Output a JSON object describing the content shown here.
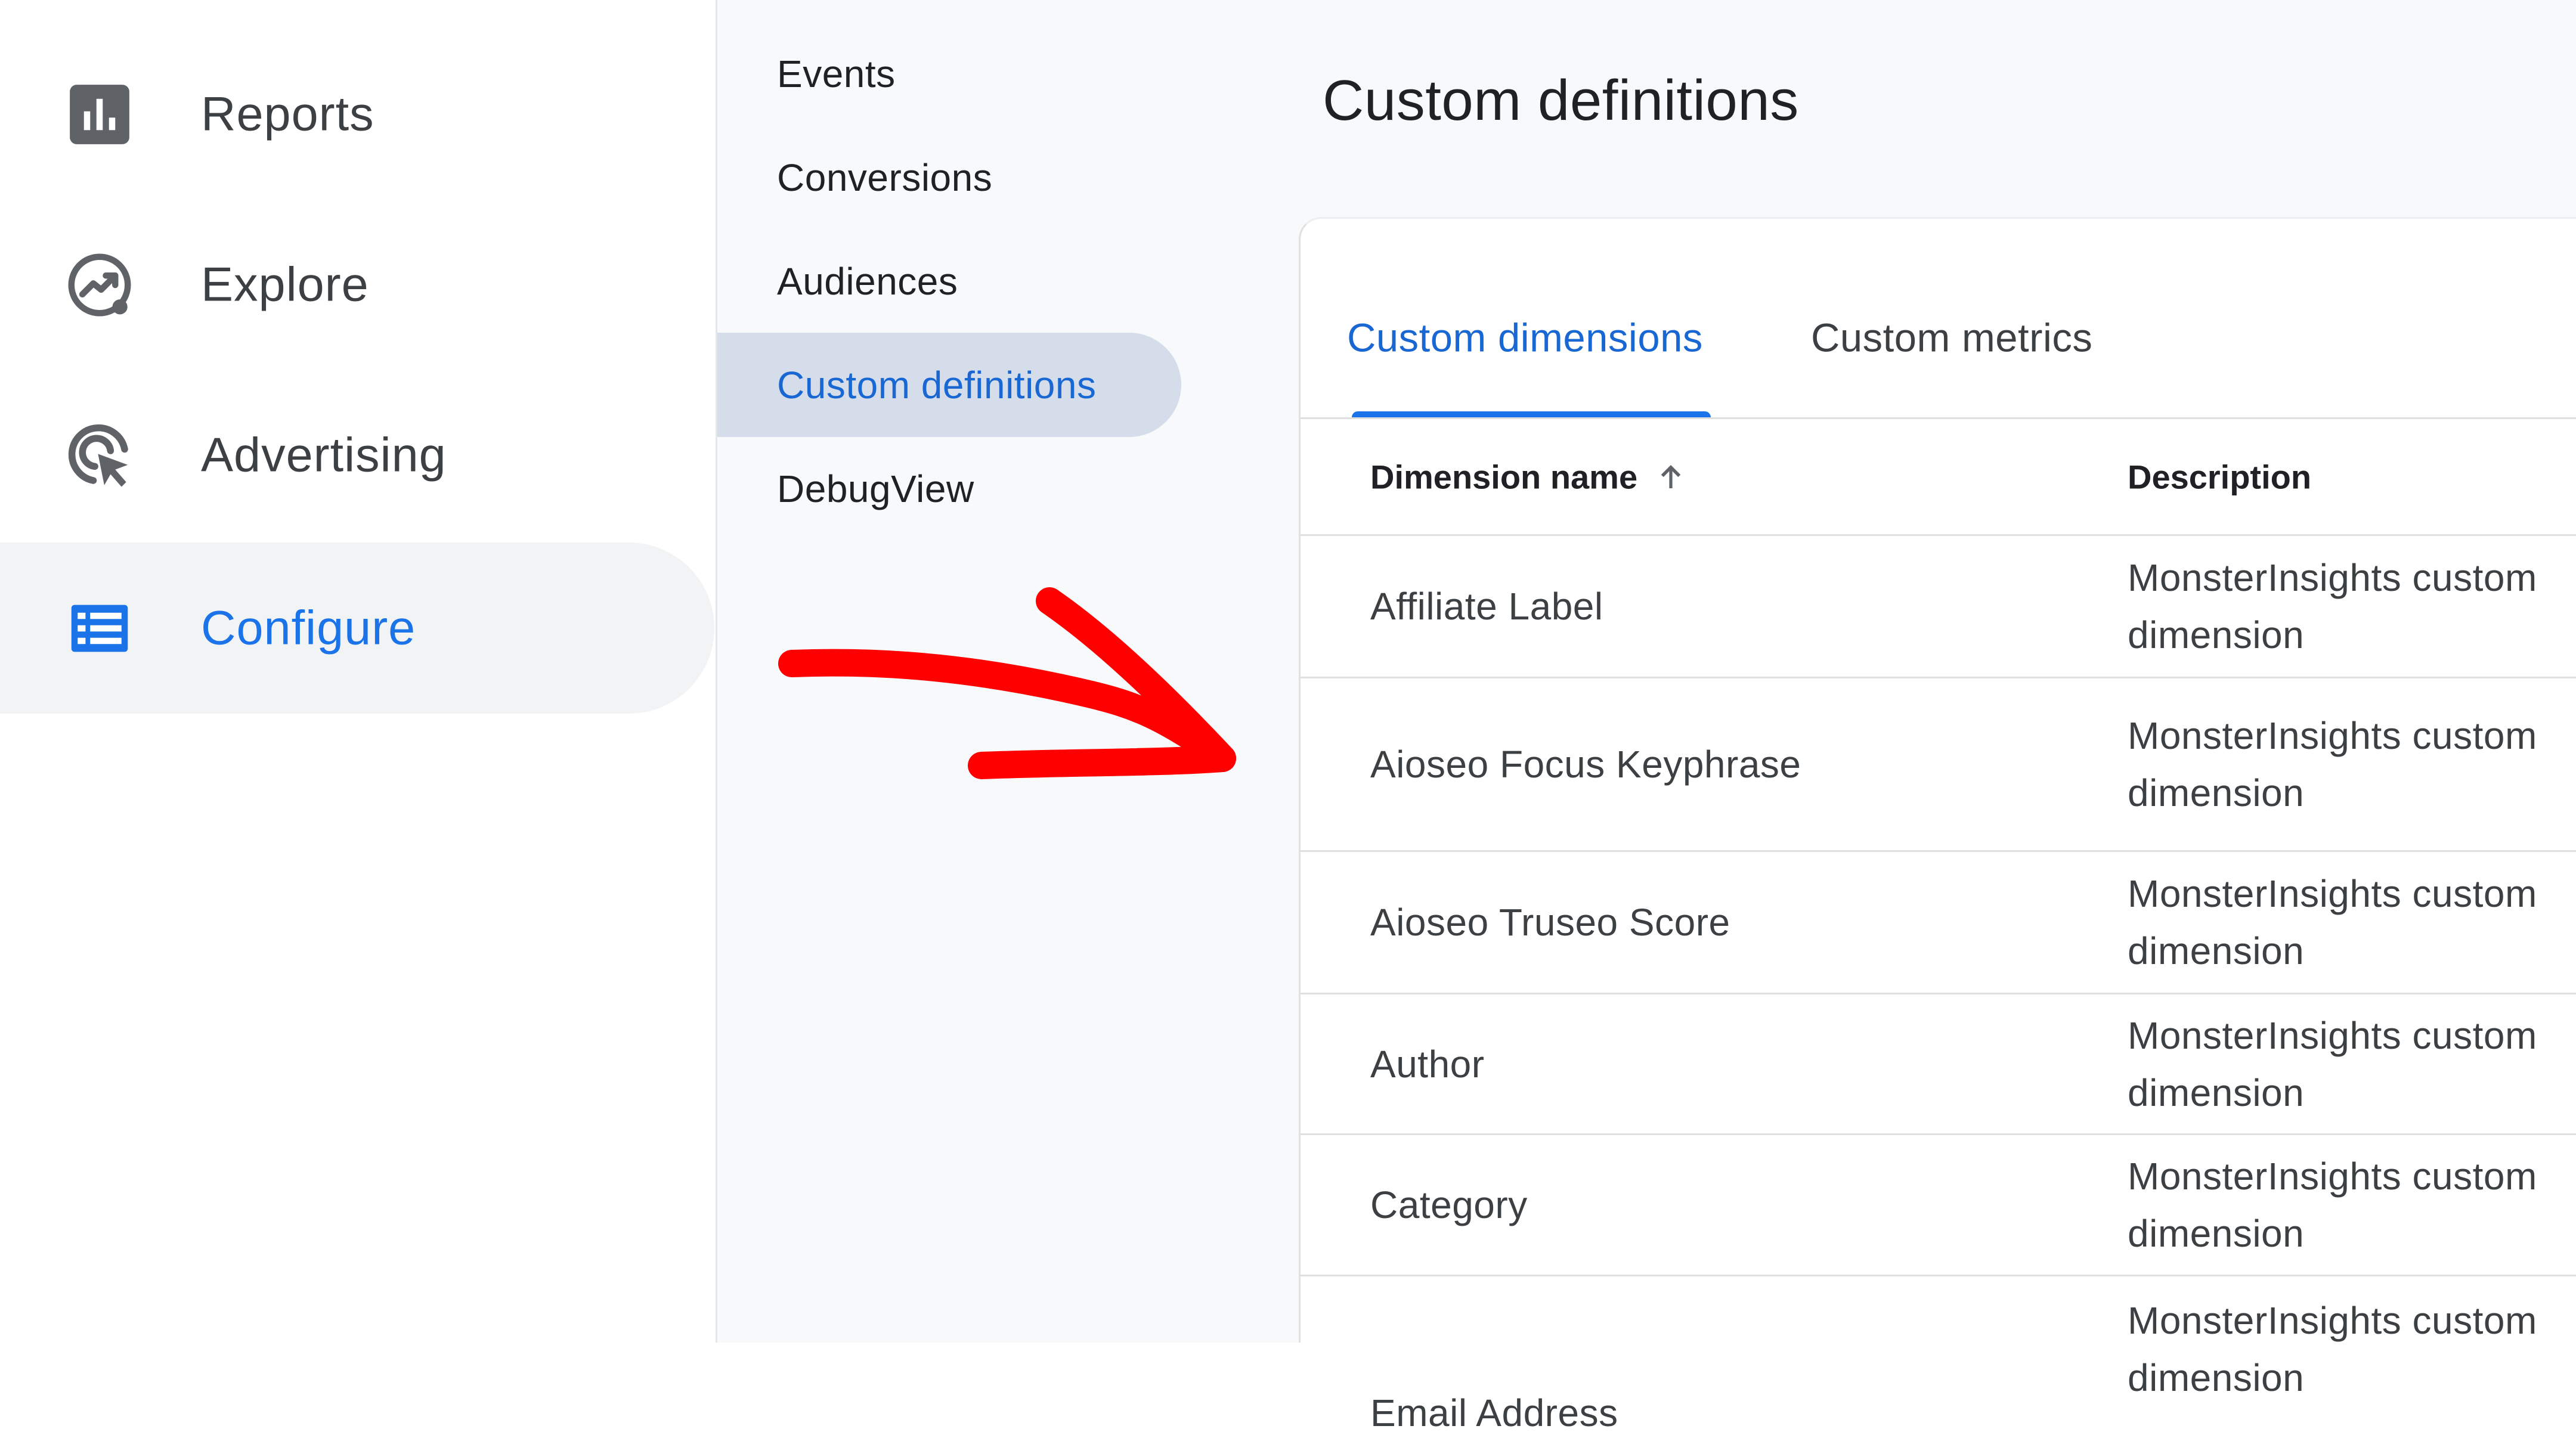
{
  "left_nav": {
    "items": [
      {
        "label": "Reports",
        "icon": "bar-chart-icon"
      },
      {
        "label": "Explore",
        "icon": "explore-trend-icon"
      },
      {
        "label": "Advertising",
        "icon": "advertising-cursor-icon"
      },
      {
        "label": "Configure",
        "icon": "list-table-icon",
        "active": true
      }
    ]
  },
  "sub_nav": {
    "items": [
      {
        "label": "Events"
      },
      {
        "label": "Conversions"
      },
      {
        "label": "Audiences"
      },
      {
        "label": "Custom definitions",
        "active": true
      },
      {
        "label": "DebugView"
      }
    ]
  },
  "main": {
    "title": "Custom definitions",
    "tabs": [
      {
        "label": "Custom dimensions",
        "active": true
      },
      {
        "label": "Custom metrics"
      }
    ],
    "table": {
      "columns": [
        "Dimension name",
        "Description"
      ],
      "sort_icon": "arrow-up-icon",
      "rows": [
        {
          "name": "Affiliate Label",
          "description": "MonsterInsights custom dimension"
        },
        {
          "name": "Aioseo Focus Keyphrase",
          "description": "MonsterInsights custom dimension"
        },
        {
          "name": "Aioseo Truseo Score",
          "description": "MonsterInsights custom dimension"
        },
        {
          "name": "Author",
          "description": "MonsterInsights custom dimension"
        },
        {
          "name": "Category",
          "description": "MonsterInsights custom dimension"
        },
        {
          "name": "Email Address",
          "description": "MonsterInsights custom dimension"
        }
      ]
    }
  },
  "annotation": {
    "icon": "red-arrow-annotation",
    "color": "#ff0000"
  },
  "colors": {
    "accent": "#1a73e8",
    "active_text": "#1967d2",
    "active_subnav_bg": "#d5dcea",
    "active_nav_bg": "#f1f3f4",
    "nav_icon": "#5f6368"
  }
}
